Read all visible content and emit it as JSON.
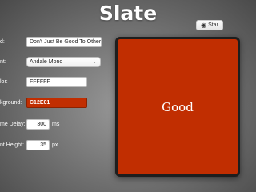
{
  "app": {
    "title": "Slate"
  },
  "github": {
    "star_label": "Star",
    "icon": "github-icon"
  },
  "form": {
    "text": {
      "label": "d:",
      "value": "Don't Just Be Good To Others"
    },
    "font": {
      "label": "nt:",
      "value": "Andale Mono"
    },
    "color": {
      "label": "lor:",
      "value": "FFFFFF"
    },
    "background": {
      "label": "kground:",
      "value": "C12E01"
    },
    "frame_delay": {
      "label": "me Delay:",
      "value": "300",
      "unit": "ms"
    },
    "font_height": {
      "label": "nt Height:",
      "value": "35",
      "unit": "px"
    }
  },
  "preview": {
    "word": "Good",
    "background_color": "#C12E01",
    "text_color": "#FFFFFF"
  }
}
